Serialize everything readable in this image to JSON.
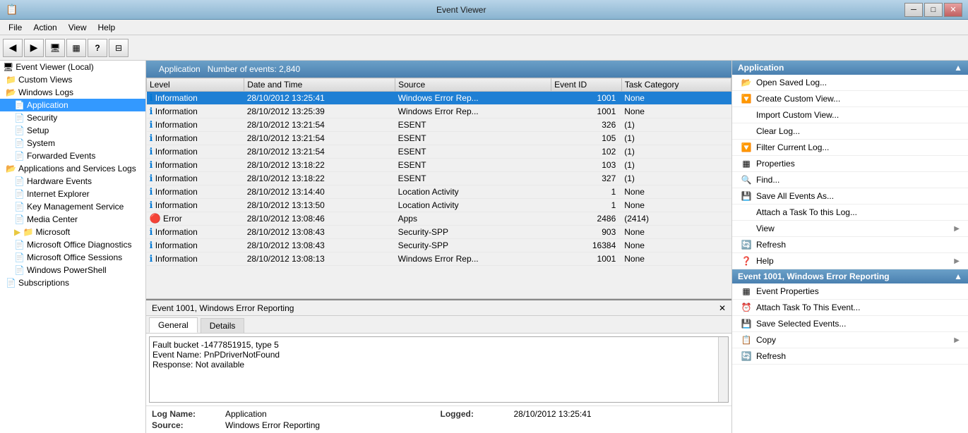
{
  "titlebar": {
    "title": "Event Viewer",
    "icon": "📋"
  },
  "menubar": {
    "items": [
      {
        "label": "File",
        "id": "file"
      },
      {
        "label": "Action",
        "id": "action"
      },
      {
        "label": "View",
        "id": "view"
      },
      {
        "label": "Help",
        "id": "help"
      }
    ]
  },
  "toolbar": {
    "buttons": [
      {
        "icon": "◀",
        "name": "back-btn"
      },
      {
        "icon": "▶",
        "name": "forward-btn"
      },
      {
        "icon": "🖥",
        "name": "computer-btn"
      },
      {
        "icon": "⊞",
        "name": "grid-btn"
      },
      {
        "icon": "?",
        "name": "help-btn"
      },
      {
        "icon": "⊟",
        "name": "table-btn"
      }
    ]
  },
  "sidebar": {
    "root_label": "Event Viewer (Local)",
    "items": [
      {
        "label": "Custom Views",
        "indent": 1,
        "icon": "folder",
        "expanded": true
      },
      {
        "label": "Windows Logs",
        "indent": 1,
        "icon": "folder",
        "expanded": true
      },
      {
        "label": "Application",
        "indent": 2,
        "icon": "log",
        "selected": true
      },
      {
        "label": "Security",
        "indent": 2,
        "icon": "log"
      },
      {
        "label": "Setup",
        "indent": 2,
        "icon": "log"
      },
      {
        "label": "System",
        "indent": 2,
        "icon": "log"
      },
      {
        "label": "Forwarded Events",
        "indent": 2,
        "icon": "log"
      },
      {
        "label": "Applications and Services Logs",
        "indent": 1,
        "icon": "folder",
        "expanded": true
      },
      {
        "label": "Hardware Events",
        "indent": 2,
        "icon": "log"
      },
      {
        "label": "Internet Explorer",
        "indent": 2,
        "icon": "log"
      },
      {
        "label": "Key Management Service",
        "indent": 2,
        "icon": "log"
      },
      {
        "label": "Media Center",
        "indent": 2,
        "icon": "log"
      },
      {
        "label": "Microsoft",
        "indent": 2,
        "icon": "folder"
      },
      {
        "label": "Microsoft Office Diagnostics",
        "indent": 2,
        "icon": "log"
      },
      {
        "label": "Microsoft Office Sessions",
        "indent": 2,
        "icon": "log"
      },
      {
        "label": "Windows PowerShell",
        "indent": 2,
        "icon": "log"
      },
      {
        "label": "Subscriptions",
        "indent": 1,
        "icon": "log"
      }
    ]
  },
  "event_list": {
    "header_title": "Application",
    "events_count": "Number of events: 2,840",
    "columns": [
      "Level",
      "Date and Time",
      "Source",
      "Event ID",
      "Task Category"
    ],
    "rows": [
      {
        "level": "Information",
        "level_type": "info",
        "datetime": "28/10/2012 13:25:41",
        "source": "Windows Error Rep...",
        "event_id": "1001",
        "category": "None",
        "selected": true
      },
      {
        "level": "Information",
        "level_type": "info",
        "datetime": "28/10/2012 13:25:39",
        "source": "Windows Error Rep...",
        "event_id": "1001",
        "category": "None"
      },
      {
        "level": "Information",
        "level_type": "info",
        "datetime": "28/10/2012 13:21:54",
        "source": "ESENT",
        "event_id": "326",
        "category": "(1)"
      },
      {
        "level": "Information",
        "level_type": "info",
        "datetime": "28/10/2012 13:21:54",
        "source": "ESENT",
        "event_id": "105",
        "category": "(1)"
      },
      {
        "level": "Information",
        "level_type": "info",
        "datetime": "28/10/2012 13:21:54",
        "source": "ESENT",
        "event_id": "102",
        "category": "(1)"
      },
      {
        "level": "Information",
        "level_type": "info",
        "datetime": "28/10/2012 13:18:22",
        "source": "ESENT",
        "event_id": "103",
        "category": "(1)"
      },
      {
        "level": "Information",
        "level_type": "info",
        "datetime": "28/10/2012 13:18:22",
        "source": "ESENT",
        "event_id": "327",
        "category": "(1)"
      },
      {
        "level": "Information",
        "level_type": "info",
        "datetime": "28/10/2012 13:14:40",
        "source": "Location Activity",
        "event_id": "1",
        "category": "None"
      },
      {
        "level": "Information",
        "level_type": "info",
        "datetime": "28/10/2012 13:13:50",
        "source": "Location Activity",
        "event_id": "1",
        "category": "None"
      },
      {
        "level": "Error",
        "level_type": "error",
        "datetime": "28/10/2012 13:08:46",
        "source": "Apps",
        "event_id": "2486",
        "category": "(2414)"
      },
      {
        "level": "Information",
        "level_type": "info",
        "datetime": "28/10/2012 13:08:43",
        "source": "Security-SPP",
        "event_id": "903",
        "category": "None"
      },
      {
        "level": "Information",
        "level_type": "info",
        "datetime": "28/10/2012 13:08:43",
        "source": "Security-SPP",
        "event_id": "16384",
        "category": "None"
      },
      {
        "level": "Information",
        "level_type": "info",
        "datetime": "28/10/2012 13:08:13",
        "source": "Windows Error Rep...",
        "event_id": "1001",
        "category": "None"
      }
    ]
  },
  "event_detail": {
    "title": "Event 1001, Windows Error Reporting",
    "close_btn": "✕",
    "tabs": [
      "General",
      "Details"
    ],
    "active_tab": "General",
    "text_content": "Fault bucket -1477851915, type 5\nEvent Name: PnPDriverNotFound\nResponse: Not available",
    "meta": {
      "log_name_label": "Log Name:",
      "log_name_value": "Application",
      "source_label": "Source:",
      "source_value": "Windows Error Reporting",
      "logged_label": "Logged:",
      "logged_value": "28/10/2012 13:25:41"
    }
  },
  "actions": {
    "section1_title": "Application",
    "items1": [
      {
        "label": "Open Saved Log...",
        "icon": "folder-open",
        "has_sub": false
      },
      {
        "label": "Create Custom View...",
        "icon": "filter",
        "has_sub": false
      },
      {
        "label": "Import Custom View...",
        "icon": "",
        "has_sub": false
      },
      {
        "label": "Clear Log...",
        "icon": "",
        "has_sub": false
      },
      {
        "label": "Filter Current Log...",
        "icon": "filter",
        "has_sub": false
      },
      {
        "label": "Properties",
        "icon": "grid",
        "has_sub": false
      },
      {
        "label": "Find...",
        "icon": "binoculars",
        "has_sub": false
      },
      {
        "label": "Save All Events As...",
        "icon": "save",
        "has_sub": false
      },
      {
        "label": "Attach a Task To this Log...",
        "icon": "",
        "has_sub": false
      },
      {
        "label": "View",
        "icon": "",
        "has_sub": true
      },
      {
        "label": "Refresh",
        "icon": "refresh",
        "has_sub": false
      },
      {
        "label": "Help",
        "icon": "help",
        "has_sub": true
      }
    ],
    "section2_title": "Event 1001, Windows Error Reporting",
    "items2": [
      {
        "label": "Event Properties",
        "icon": "grid",
        "has_sub": false
      },
      {
        "label": "Attach Task To This Event...",
        "icon": "clock",
        "has_sub": false
      },
      {
        "label": "Save Selected Events...",
        "icon": "save",
        "has_sub": false
      },
      {
        "label": "Copy",
        "icon": "copy",
        "has_sub": true
      },
      {
        "label": "Refresh",
        "icon": "refresh",
        "has_sub": false
      }
    ]
  }
}
